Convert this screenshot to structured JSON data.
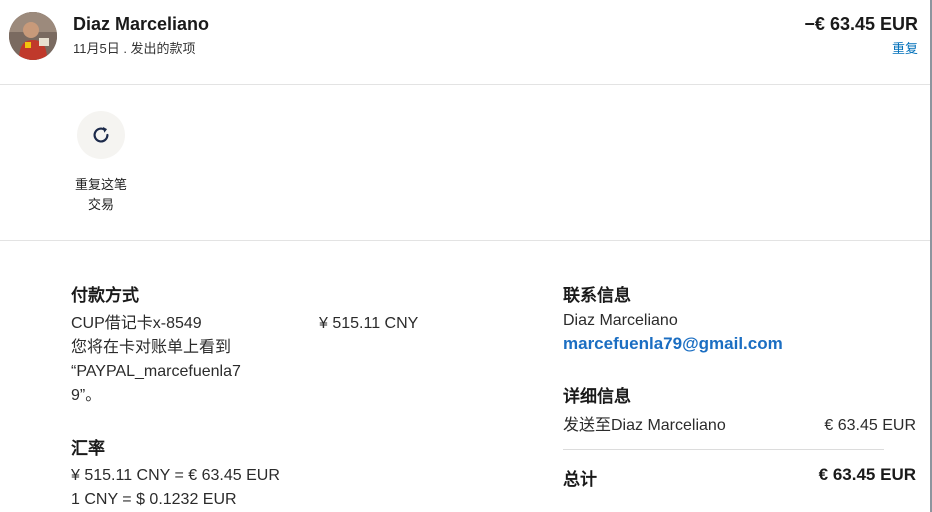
{
  "header": {
    "merchant_name": "Diaz Marceliano",
    "subtitle": "11月5日 . 发出的款项",
    "amount": "−€ 63.45 EUR",
    "repeat_link": "重复"
  },
  "action": {
    "repeat_label_line1": "重复这笔",
    "repeat_label_line2": "交易"
  },
  "payment": {
    "title": "付款方式",
    "card": "CUP借记卡x-8549",
    "amount": "¥ 515.11 CNY",
    "statement_line1": "您将在卡对账单上看到",
    "statement_line2": "“PAYPAL_marcefuenla7",
    "statement_line3": "9”。"
  },
  "exchange": {
    "title": "汇率",
    "line1": "¥ 515.11 CNY = € 63.45 EUR",
    "line2": "1 CNY = $ 0.1232 EUR"
  },
  "contact": {
    "title": "联系信息",
    "name": "Diaz Marceliano",
    "email": "marcefuenla79@gmail.com"
  },
  "details": {
    "title": "详细信息",
    "sent_to": "发送至Diaz Marceliano",
    "sent_amount": "€ 63.45 EUR",
    "total_label": "总计",
    "total_amount": "€ 63.45 EUR"
  }
}
